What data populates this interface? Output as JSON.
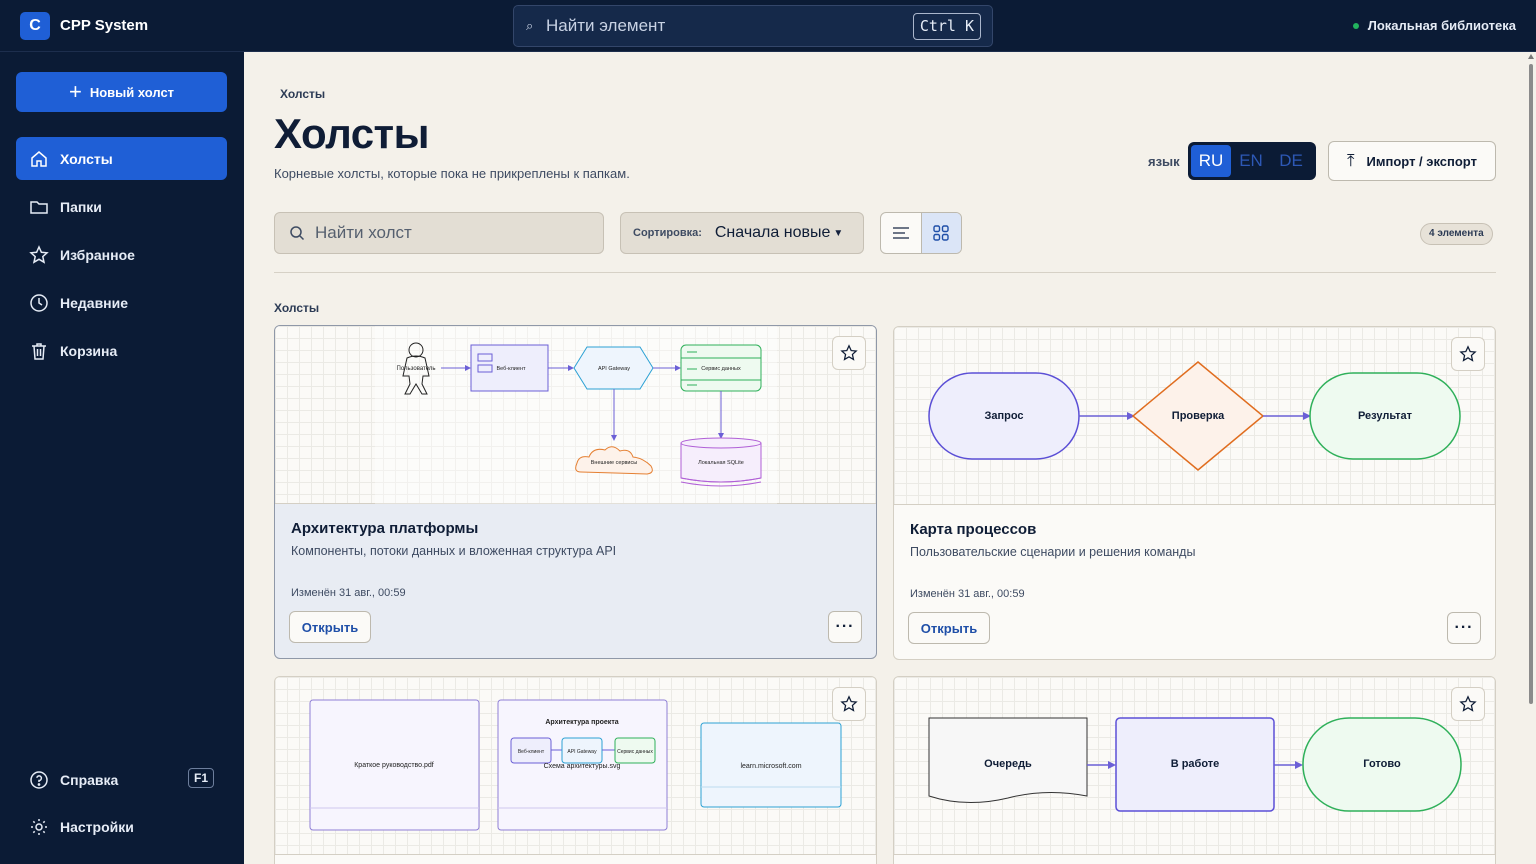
{
  "app": {
    "logo_letter": "C",
    "name": "CPP System",
    "library_status": "Локальная библиотека",
    "status_color": "#22b35e"
  },
  "topbar": {
    "search_placeholder": "Найти элемент",
    "shortcut": "Ctrl K"
  },
  "sidebar": {
    "new_button": "Новый холст",
    "items": [
      {
        "label": "Холсты",
        "icon": "home-icon",
        "active": true
      },
      {
        "label": "Папки",
        "icon": "folder-icon"
      },
      {
        "label": "Избранное",
        "icon": "star-icon"
      },
      {
        "label": "Недавние",
        "icon": "clock-icon"
      },
      {
        "label": "Корзина",
        "icon": "trash-icon"
      }
    ],
    "help": {
      "label": "Справка",
      "shortcut": "F1",
      "icon": "help-icon"
    },
    "settings": {
      "label": "Настройки",
      "icon": "gear-icon"
    }
  },
  "page": {
    "breadcrumb": "Холсты",
    "title": "Холсты",
    "subtitle": "Корневые холсты, которые пока не прикреплены к папкам.",
    "lang_label": "язык",
    "languages": [
      "RU",
      "EN",
      "DE"
    ],
    "active_language": "RU",
    "import_export": "Импорт / экспорт",
    "search_placeholder": "Найти холст",
    "sort_label": "Сортировка:",
    "sort_value": "Сначала новые",
    "count": "4 элемента",
    "section_title": "Холсты"
  },
  "colors": {
    "accent": "#1f5fd6",
    "navy": "#0b1b35",
    "background": "#f4f1ea"
  },
  "cards": [
    {
      "title": "Архитектура платформы",
      "description": "Компоненты, потоки данных и вложенная структура API",
      "modified": "Изменён 31 авг., 00:59",
      "open": "Открыть",
      "preview": {
        "user": "Пользователь",
        "web": "Веб-клиент",
        "gateway": "API Gateway",
        "service": "Сервис данных",
        "external": "Внешние сервисы",
        "db": "Локальная SQLite"
      }
    },
    {
      "title": "Карта процессов",
      "description": "Пользовательские сценарии и решения команды",
      "modified": "Изменён 31 авг., 00:59",
      "open": "Открыть",
      "preview": {
        "request": "Запрос",
        "check": "Проверка",
        "result": "Результат"
      }
    },
    {
      "preview": {
        "pdf": "Краткое руководство.pdf",
        "arch_title": "Архитектура проекта",
        "web": "Веб-клиент",
        "gateway": "API Gateway",
        "service": "Сервис данных",
        "svg": "Схема архитектуры.svg",
        "link": "learn.microsoft.com"
      }
    },
    {
      "preview": {
        "queue": "Очередь",
        "in_progress": "В работе",
        "done": "Готово"
      }
    }
  ]
}
